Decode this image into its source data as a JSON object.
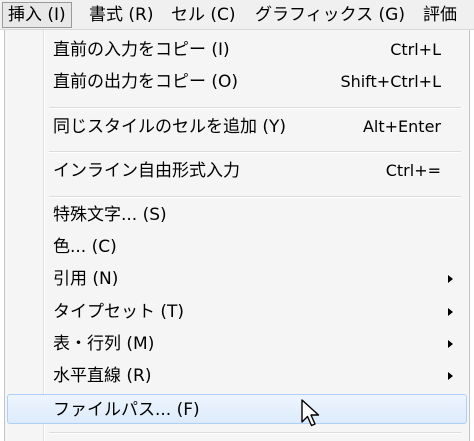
{
  "menubar": {
    "items": [
      {
        "label": "挿入 (I)"
      },
      {
        "label": "書式 (R)"
      },
      {
        "label": "セル (C)"
      },
      {
        "label": "グラフィックス (G)"
      },
      {
        "label": "評価"
      }
    ]
  },
  "menu": {
    "items": [
      {
        "label": "直前の入力をコピー (I)",
        "shortcut": "Ctrl+L"
      },
      {
        "label": "直前の出力をコピー (O)",
        "shortcut": "Shift+Ctrl+L"
      },
      {
        "label": "同じスタイルのセルを追加 (Y)",
        "shortcut": "Alt+Enter"
      },
      {
        "label": "インライン自由形式入力",
        "shortcut": "Ctrl+="
      },
      {
        "label": "特殊文字... (S)"
      },
      {
        "label": "色... (C)"
      },
      {
        "label": "引用 (N)",
        "submenu": true
      },
      {
        "label": "タイプセット (T)",
        "submenu": true
      },
      {
        "label": "表・行列 (M)",
        "submenu": true
      },
      {
        "label": "水平直線 (R)",
        "submenu": true
      },
      {
        "label": "ファイルパス... (F)",
        "highlighted": true
      }
    ]
  }
}
